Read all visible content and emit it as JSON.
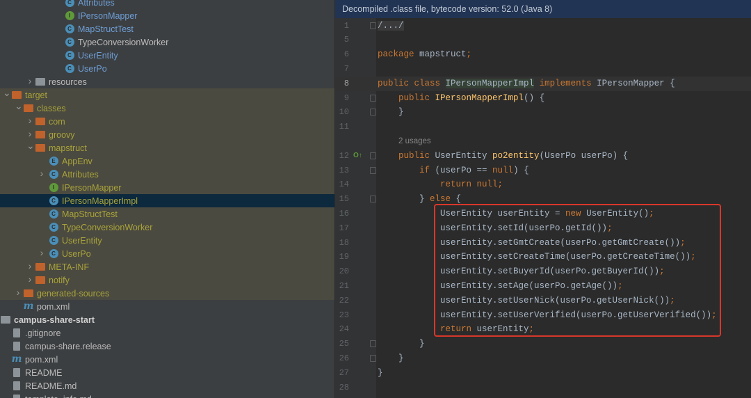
{
  "tree": [
    {
      "level": 4,
      "chev": "",
      "icon": "class",
      "label": "Attributes",
      "style": "blue"
    },
    {
      "level": 4,
      "chev": "",
      "icon": "interface",
      "label": "IPersonMapper",
      "style": "blue"
    },
    {
      "level": 4,
      "chev": "",
      "icon": "test",
      "label": "MapStructTest",
      "style": "blue"
    },
    {
      "level": 4,
      "chev": "",
      "icon": "class",
      "label": "TypeConversionWorker",
      "style": ""
    },
    {
      "level": 4,
      "chev": "",
      "icon": "class",
      "label": "UserEntity",
      "style": "blue"
    },
    {
      "level": 4,
      "chev": "",
      "icon": "class",
      "label": "UserPo",
      "style": "blue"
    },
    {
      "level": 2,
      "chev": "right",
      "icon": "resfolder",
      "label": "resources",
      "style": ""
    },
    {
      "level": 0,
      "chev": "down",
      "icon": "folder",
      "label": "target",
      "style": "excl"
    },
    {
      "level": 1,
      "chev": "down",
      "icon": "folder",
      "label": "classes",
      "style": "excl"
    },
    {
      "level": 2,
      "chev": "right",
      "icon": "folder",
      "label": "com",
      "style": "excl"
    },
    {
      "level": 2,
      "chev": "right",
      "icon": "folder",
      "label": "groovy",
      "style": "excl"
    },
    {
      "level": 2,
      "chev": "down",
      "icon": "folder",
      "label": "mapstruct",
      "style": "excl"
    },
    {
      "level": 3,
      "chev": "",
      "icon": "enum",
      "label": "AppEnv",
      "style": "excl"
    },
    {
      "level": 3,
      "chev": "right",
      "icon": "class",
      "label": "Attributes",
      "style": "excl"
    },
    {
      "level": 3,
      "chev": "",
      "icon": "interface",
      "label": "IPersonMapper",
      "style": "excl"
    },
    {
      "level": 3,
      "chev": "",
      "icon": "class",
      "label": "IPersonMapperImpl",
      "style": "sel"
    },
    {
      "level": 3,
      "chev": "",
      "icon": "test",
      "label": "MapStructTest",
      "style": "excl"
    },
    {
      "level": 3,
      "chev": "",
      "icon": "class",
      "label": "TypeConversionWorker",
      "style": "excl"
    },
    {
      "level": 3,
      "chev": "",
      "icon": "class",
      "label": "UserEntity",
      "style": "excl"
    },
    {
      "level": 3,
      "chev": "right",
      "icon": "class",
      "label": "UserPo",
      "style": "excl"
    },
    {
      "level": 2,
      "chev": "right",
      "icon": "folder",
      "label": "META-INF",
      "style": "excl"
    },
    {
      "level": 2,
      "chev": "right",
      "icon": "folder",
      "label": "notify",
      "style": "excl"
    },
    {
      "level": 1,
      "chev": "right",
      "icon": "folder",
      "label": "generated-sources",
      "style": "excl"
    },
    {
      "level": 1,
      "chev": "",
      "icon": "maven",
      "label": "pom.xml",
      "style": ""
    },
    {
      "level": 0,
      "chev": "",
      "icon": "module",
      "label": "campus-share-start",
      "style": "bold"
    },
    {
      "level": 0,
      "chev": "",
      "icon": "file",
      "label": ".gitignore",
      "style": ""
    },
    {
      "level": 0,
      "chev": "",
      "icon": "file",
      "label": "campus-share.release",
      "style": ""
    },
    {
      "level": 0,
      "chev": "",
      "icon": "maven",
      "label": "pom.xml",
      "style": ""
    },
    {
      "level": 0,
      "chev": "",
      "icon": "file",
      "label": "README",
      "style": ""
    },
    {
      "level": 0,
      "chev": "",
      "icon": "file",
      "label": "README.md",
      "style": ""
    },
    {
      "level": 0,
      "chev": "",
      "icon": "file",
      "label": "template_info.md",
      "style": ""
    }
  ],
  "editor": {
    "banner": "Decompiled .class file, bytecode version: 52.0 (Java 8)",
    "usages": "2 usages",
    "lines": [
      {
        "n": "1",
        "fold": true,
        "t": [
          [
            "fold-tx",
            "/.../"
          ]
        ]
      },
      {
        "n": "5",
        "t": []
      },
      {
        "n": "6",
        "t": [
          [
            "kw",
            "package "
          ],
          [
            "",
            "mapstruct"
          ],
          [
            "kw",
            ";"
          ]
        ]
      },
      {
        "n": "7",
        "t": []
      },
      {
        "n": "8",
        "cur": true,
        "t": [
          [
            "kw",
            "public class "
          ],
          [
            "hl",
            "IPersonMapperImpl"
          ],
          [
            "kw",
            " implements "
          ],
          [
            "",
            "IPersonMapper {"
          ]
        ]
      },
      {
        "n": "9",
        "fold": true,
        "t": [
          [
            "",
            "    "
          ],
          [
            "kw",
            "public "
          ],
          [
            "fn",
            "IPersonMapperImpl"
          ],
          [
            "",
            "() {"
          ]
        ]
      },
      {
        "n": "10",
        "fold": true,
        "t": [
          [
            "",
            "    }"
          ]
        ]
      },
      {
        "n": "11",
        "t": []
      },
      {
        "usages": true
      },
      {
        "n": "12",
        "fold": true,
        "gutterIcon": "O↑",
        "t": [
          [
            "",
            "    "
          ],
          [
            "kw",
            "public "
          ],
          [
            "",
            "UserEntity "
          ],
          [
            "fn",
            "po2entity"
          ],
          [
            "",
            "(UserPo userPo) {"
          ]
        ]
      },
      {
        "n": "13",
        "fold": true,
        "t": [
          [
            "",
            "        "
          ],
          [
            "kw",
            "if "
          ],
          [
            "",
            "(userPo == "
          ],
          [
            "kw",
            "null"
          ],
          [
            "",
            ") {"
          ]
        ]
      },
      {
        "n": "14",
        "t": [
          [
            "",
            "            "
          ],
          [
            "kw",
            "return null;"
          ]
        ]
      },
      {
        "n": "15",
        "fold": true,
        "t": [
          [
            "",
            "        } "
          ],
          [
            "kw",
            "else "
          ],
          [
            "",
            "{"
          ]
        ]
      },
      {
        "n": "16",
        "t": [
          [
            "",
            "            UserEntity userEntity = "
          ],
          [
            "kw",
            "new "
          ],
          [
            "",
            "UserEntity()"
          ],
          [
            "kw",
            ";"
          ]
        ]
      },
      {
        "n": "17",
        "t": [
          [
            "",
            "            userEntity.setId(userPo.getId())"
          ],
          [
            "kw",
            ";"
          ]
        ]
      },
      {
        "n": "18",
        "t": [
          [
            "",
            "            userEntity.setGmtCreate(userPo.getGmtCreate())"
          ],
          [
            "kw",
            ";"
          ]
        ]
      },
      {
        "n": "19",
        "t": [
          [
            "",
            "            userEntity.setCreateTime(userPo.getCreateTime())"
          ],
          [
            "kw",
            ";"
          ]
        ]
      },
      {
        "n": "20",
        "t": [
          [
            "",
            "            userEntity.setBuyerId(userPo.getBuyerId())"
          ],
          [
            "kw",
            ";"
          ]
        ]
      },
      {
        "n": "21",
        "t": [
          [
            "",
            "            userEntity.setAge(userPo.getAge())"
          ],
          [
            "kw",
            ";"
          ]
        ]
      },
      {
        "n": "22",
        "t": [
          [
            "",
            "            userEntity.setUserNick(userPo.getUserNick())"
          ],
          [
            "kw",
            ";"
          ]
        ]
      },
      {
        "n": "23",
        "t": [
          [
            "",
            "            userEntity.setUserVerified(userPo.getUserVerified())"
          ],
          [
            "kw",
            ";"
          ]
        ]
      },
      {
        "n": "24",
        "t": [
          [
            "",
            "            "
          ],
          [
            "kw",
            "return "
          ],
          [
            "",
            "userEntity"
          ],
          [
            "kw",
            ";"
          ]
        ]
      },
      {
        "n": "25",
        "fold": true,
        "t": [
          [
            "",
            "        }"
          ]
        ]
      },
      {
        "n": "26",
        "fold": true,
        "t": [
          [
            "",
            "    }"
          ]
        ]
      },
      {
        "n": "27",
        "t": [
          [
            "",
            "}"
          ]
        ]
      },
      {
        "n": "28",
        "t": []
      }
    ]
  }
}
